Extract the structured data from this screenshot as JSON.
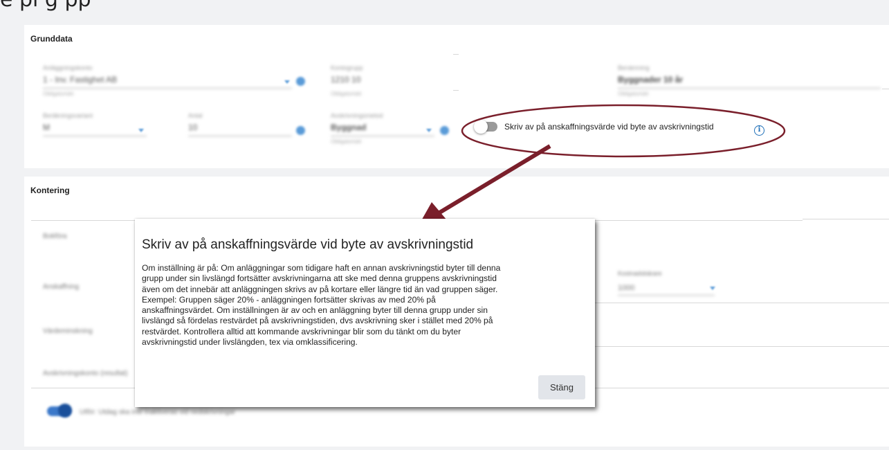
{
  "page": {
    "title_partial": "e pi g pp"
  },
  "grunddata": {
    "title": "Grunddata",
    "fields": [
      {
        "label": "Anläggningskonto",
        "value": "1 - Inv. Fastighet AB",
        "helper": "Obligatoriskt"
      },
      {
        "label": "Kontogrupp",
        "value": "1210 10",
        "helper": "Obligatoriskt"
      },
      {
        "label": "Benämning",
        "value": "Byggnader 10 år",
        "helper": "Obligatoriskt"
      },
      {
        "label": "Beräkningsvariant",
        "value": "M",
        "helper": ""
      },
      {
        "label": "Antal",
        "value": "10",
        "helper": ""
      },
      {
        "label": "Avskrivningsmetod",
        "value": "Byggnad",
        "helper": "Obligatoriskt"
      }
    ],
    "toggle": {
      "label": "Skriv av på anskaffningsvärde vid byte av avskrivningstid",
      "checked": false,
      "info_icon": "info-icon"
    }
  },
  "kontering": {
    "title": "Kontering",
    "rows": [
      {
        "label": "Bokföra"
      },
      {
        "label": "Anskaffning",
        "right_label": "Kostnadsbärare",
        "right_value": "1000"
      },
      {
        "label": "Värdeminskning"
      },
      {
        "label": "Avskrivningskonto (resultat)"
      }
    ],
    "toggle_label": "Utför: Utdag ska inte inaktiveras vid nedskrivningar"
  },
  "dialog": {
    "title": "Skriv av på anskaffningsvärde vid byte av avskrivningstid",
    "body_lines": [
      "Om inställning är på: Om anläggningar som tidigare haft en annan avskrivningstid byter till denna",
      "grupp under sin livslängd fortsätter avskrivningarna att ske med denna gruppens avskrivningstid",
      "även om det innebär att anläggningen skrivs av på kortare eller längre tid än vad gruppen säger.",
      "Exempel: Gruppen säger 20% - anläggningen fortsätter skrivas av med 20% på",
      "anskaffningsvärdet. Om inställningen är av och en anläggning byter till denna grupp under sin",
      "livslängd så fördelas restvärdet på avskrivningstiden, dvs avskrivning sker i stället med 20% på",
      "restvärdet. Kontrollera alltid att kommande avskrivningar blir som du tänkt om du byter",
      "avskrivningstid under livslängden, tex via omklassificering."
    ],
    "close_label": "Stäng"
  },
  "colors": {
    "annotation": "#7a1f2b",
    "accent": "#1e6fb8",
    "toggle_off": "#9a9a9a"
  }
}
